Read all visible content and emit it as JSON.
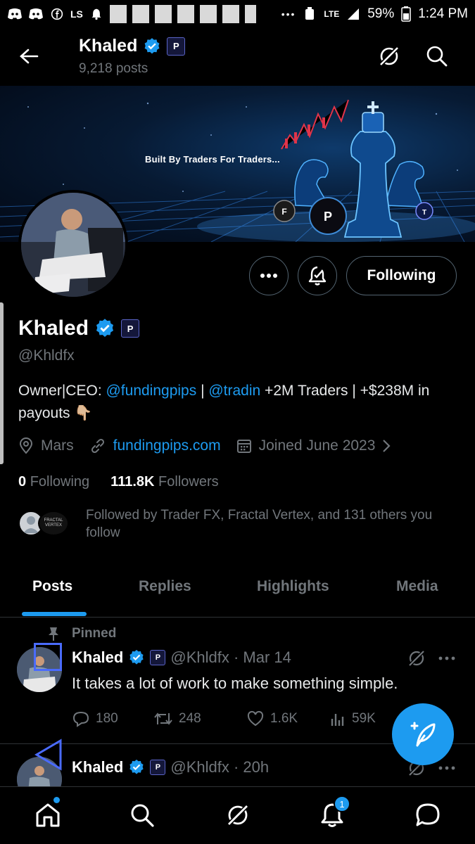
{
  "status_bar": {
    "carrier_icons": [
      "discord-icon",
      "discord-icon",
      "facebook-icon",
      "ls-icon",
      "notification-bell-icon"
    ],
    "ls_label": "LS",
    "dots": "•••",
    "lte": "LTE",
    "battery": "59%",
    "time": "1:24 PM"
  },
  "header": {
    "name": "Khaled",
    "posts_count": "9,218 posts"
  },
  "banner": {
    "tagline": "Built By Traders For Traders..."
  },
  "profile": {
    "name": "Khaled",
    "handle": "@Khldfx",
    "affiliate_badge": "P",
    "follow_button": "Following",
    "bio_prefix": "Owner|CEO: ",
    "bio_mention1": "@fundingpips",
    "bio_sep": " | ",
    "bio_mention2": "@tradin",
    "bio_suffix": " +2M Traders | +$238M in payouts 👇🏼",
    "location": "Mars",
    "website": "fundingpips.com",
    "joined": "Joined June 2023",
    "following_count": "0",
    "following_label": "Following",
    "followers_count": "111.8K",
    "followers_label": "Followers",
    "followed_by": "Followed by Trader FX, Fractal Vertex, and 131 others you follow",
    "fv_logo_text": "FRACTAL VERTEX"
  },
  "tabs": [
    {
      "label": "Posts",
      "active": true
    },
    {
      "label": "Replies",
      "active": false
    },
    {
      "label": "Highlights",
      "active": false
    },
    {
      "label": "Media",
      "active": false
    }
  ],
  "posts": [
    {
      "pinned_label": "Pinned",
      "author": "Khaled",
      "handle_time": "@Khldfx · Mar 14",
      "text": "It takes a lot of work to make something simple.",
      "replies": "180",
      "reposts": "248",
      "likes": "1.6K",
      "views": "59K"
    },
    {
      "author": "Khaled",
      "handle_time": "@Khldfx · 20h"
    }
  ],
  "bottom_nav": {
    "notification_count": "1"
  },
  "colors": {
    "accent": "#1d9bf0",
    "muted": "#71767b",
    "border": "#2f3336"
  }
}
